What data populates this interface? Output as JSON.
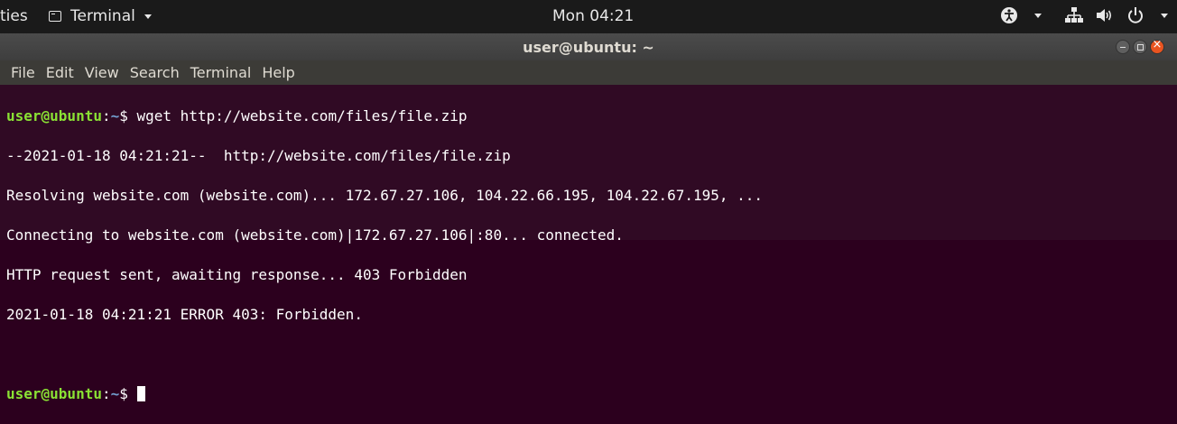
{
  "topbar": {
    "activities": "ties",
    "app_menu": "Terminal",
    "clock": "Mon 04:21"
  },
  "window": {
    "title": "user@ubuntu: ~"
  },
  "menubar": {
    "items": [
      "File",
      "Edit",
      "View",
      "Search",
      "Terminal",
      "Help"
    ]
  },
  "terminal": {
    "prompt_user": "user@ubuntu",
    "prompt_sep": ":",
    "prompt_path": "~",
    "prompt_symbol": "$ ",
    "command": "wget http://website.com/files/file.zip",
    "output": [
      "--2021-01-18 04:21:21--  http://website.com/files/file.zip",
      "Resolving website.com (website.com)... 172.67.27.106, 104.22.66.195, 104.22.67.195, ...",
      "Connecting to website.com (website.com)|172.67.27.106|:80... connected.",
      "HTTP request sent, awaiting response... 403 Forbidden",
      "2021-01-18 04:21:21 ERROR 403: Forbidden."
    ]
  },
  "colors": {
    "terminal_bg": "#300a24",
    "prompt_user": "#8ae234",
    "prompt_path": "#729fcf"
  },
  "icons": [
    "terminal-app-icon",
    "accessibility-icon",
    "network-icon",
    "volume-icon",
    "power-icon"
  ]
}
